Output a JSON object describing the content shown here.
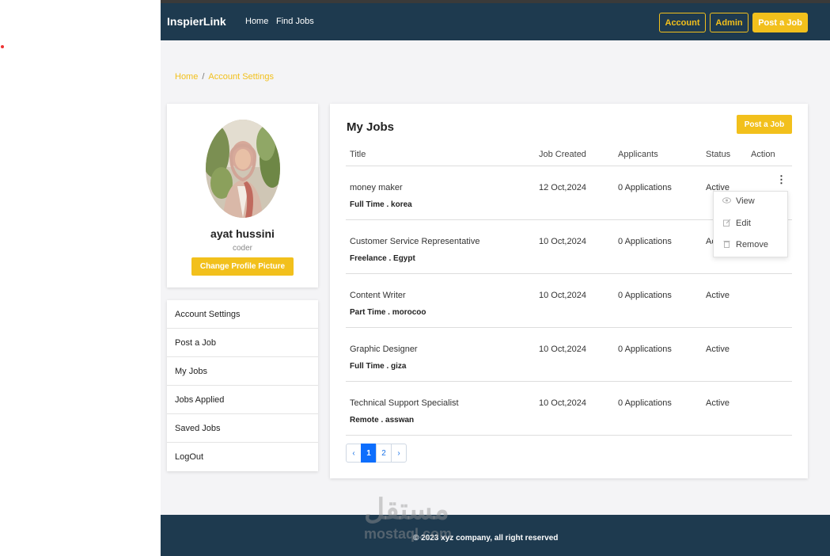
{
  "navbar": {
    "brand": "InspierLink",
    "links": [
      "Home",
      "Find Jobs"
    ],
    "account_label": "Account",
    "admin_label": "Admin",
    "post_job_label": "Post a Job"
  },
  "breadcrumb": {
    "home": "Home",
    "separator": "/",
    "current": "Account Settings"
  },
  "profile": {
    "name": "ayat hussini",
    "role": "coder",
    "change_picture_label": "Change Profile Picture"
  },
  "sidebar": {
    "items": [
      {
        "label": "Account Settings"
      },
      {
        "label": "Post a Job"
      },
      {
        "label": "My Jobs"
      },
      {
        "label": "Jobs Applied"
      },
      {
        "label": "Saved Jobs"
      },
      {
        "label": "LogOut"
      }
    ]
  },
  "jobs": {
    "title": "My Jobs",
    "post_button": "Post a Job",
    "columns": [
      "Title",
      "Job Created",
      "Applicants",
      "Status",
      "Action"
    ],
    "rows": [
      {
        "title": "money maker",
        "meta": "Full Time . korea",
        "created": "12 Oct,2024",
        "applicants": "0 Applications",
        "status": "Active"
      },
      {
        "title": "Customer Service Representative",
        "meta": "Freelance . Egypt",
        "created": "10 Oct,2024",
        "applicants": "0 Applications",
        "status": "Ac"
      },
      {
        "title": "Content Writer",
        "meta": "Part Time . morocoo",
        "created": "10 Oct,2024",
        "applicants": "0 Applications",
        "status": "Active"
      },
      {
        "title": "Graphic Designer",
        "meta": "Full Time . giza",
        "created": "10 Oct,2024",
        "applicants": "0 Applications",
        "status": "Active"
      },
      {
        "title": "Technical Support Specialist",
        "meta": "Remote . asswan",
        "created": "10 Oct,2024",
        "applicants": "0 Applications",
        "status": "Active"
      }
    ],
    "action_menu": {
      "kebab": "⋮",
      "items": [
        {
          "label": "View",
          "icon": "eye-icon"
        },
        {
          "label": "Edit",
          "icon": "edit-icon"
        },
        {
          "label": "Remove",
          "icon": "trash-icon"
        }
      ]
    },
    "pagination": {
      "prev": "‹",
      "pages": [
        "1",
        "2"
      ],
      "next": "›",
      "current": "1"
    }
  },
  "footer": {
    "text": "© 2023 xyz company, all right reserved",
    "watermark_ar": "مستقل",
    "watermark_en": "mostaql.com"
  },
  "colors": {
    "navbar": "#1e3a4f",
    "accent": "#f2c01c",
    "page_bg": "#f4f4f6",
    "pagination_active": "#0d6efd"
  }
}
